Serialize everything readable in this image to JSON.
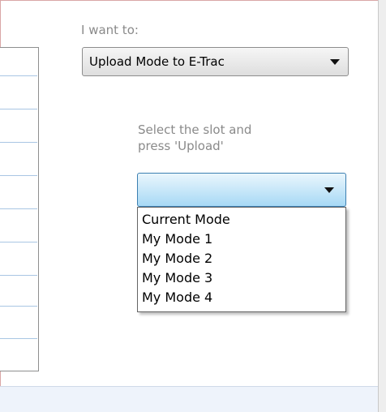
{
  "panel": {
    "want_label": "I want to:",
    "action_select": {
      "value": "Upload Mode to E-Trac"
    },
    "hint_line1": "Select the slot and",
    "hint_line2": "press 'Upload'",
    "slot_select": {
      "value": ""
    },
    "slot_options": [
      "Current Mode",
      "My Mode 1",
      "My Mode 2",
      "My Mode 3",
      "My Mode 4"
    ]
  },
  "icons": {
    "dropdown_arrow": "chevron-down-icon"
  },
  "colors": {
    "frame_border": "#d9a6a6",
    "list_divider": "#a9c6e4",
    "slot_select_focus": "#3c7fb1",
    "footer_bg": "#eef3fb"
  }
}
